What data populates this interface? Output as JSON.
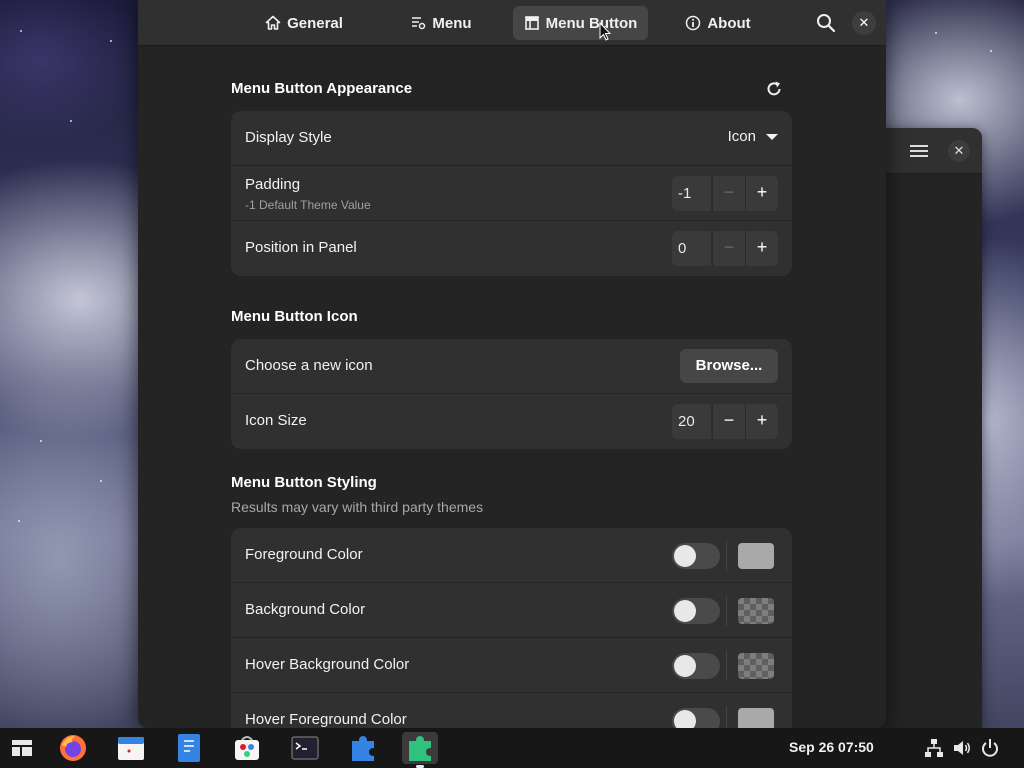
{
  "header": {
    "tabs": [
      {
        "label": "General",
        "icon": "home-icon"
      },
      {
        "label": "Menu",
        "icon": "menu-settings-icon"
      },
      {
        "label": "Menu Button",
        "icon": "layout-icon",
        "active": true
      },
      {
        "label": "About",
        "icon": "info-icon"
      }
    ]
  },
  "sections": {
    "appearance": {
      "title": "Menu Button Appearance",
      "display_style": {
        "label": "Display Style",
        "value": "Icon"
      },
      "padding": {
        "label": "Padding",
        "sub": "-1 Default Theme Value",
        "value": "-1"
      },
      "position": {
        "label": "Position in Panel",
        "value": "0"
      }
    },
    "icon": {
      "title": "Menu Button Icon",
      "choose": {
        "label": "Choose a new icon",
        "button": "Browse..."
      },
      "size": {
        "label": "Icon Size",
        "value": "20"
      }
    },
    "styling": {
      "title": "Menu Button Styling",
      "subtitle": "Results may vary with third party themes",
      "rows": [
        {
          "label": "Foreground Color",
          "swatch": "solid",
          "enabled": false
        },
        {
          "label": "Background Color",
          "swatch": "checker",
          "enabled": false
        },
        {
          "label": "Hover Background Color",
          "swatch": "checker",
          "enabled": false
        },
        {
          "label": "Hover Foreground Color",
          "swatch": "solid",
          "enabled": false
        }
      ]
    }
  },
  "spin": {
    "minus": "−",
    "plus": "+"
  },
  "taskbar": {
    "clock": "Sep 26  07:50",
    "apps": [
      "activities-icon",
      "firefox-icon",
      "calendar-icon",
      "text-editor-icon",
      "software-icon",
      "terminal-icon",
      "extensions-icon",
      "extension-manager-icon"
    ]
  },
  "colors": {
    "accent": "#3584e4",
    "window_bg": "#242424",
    "card_bg": "#303030"
  }
}
